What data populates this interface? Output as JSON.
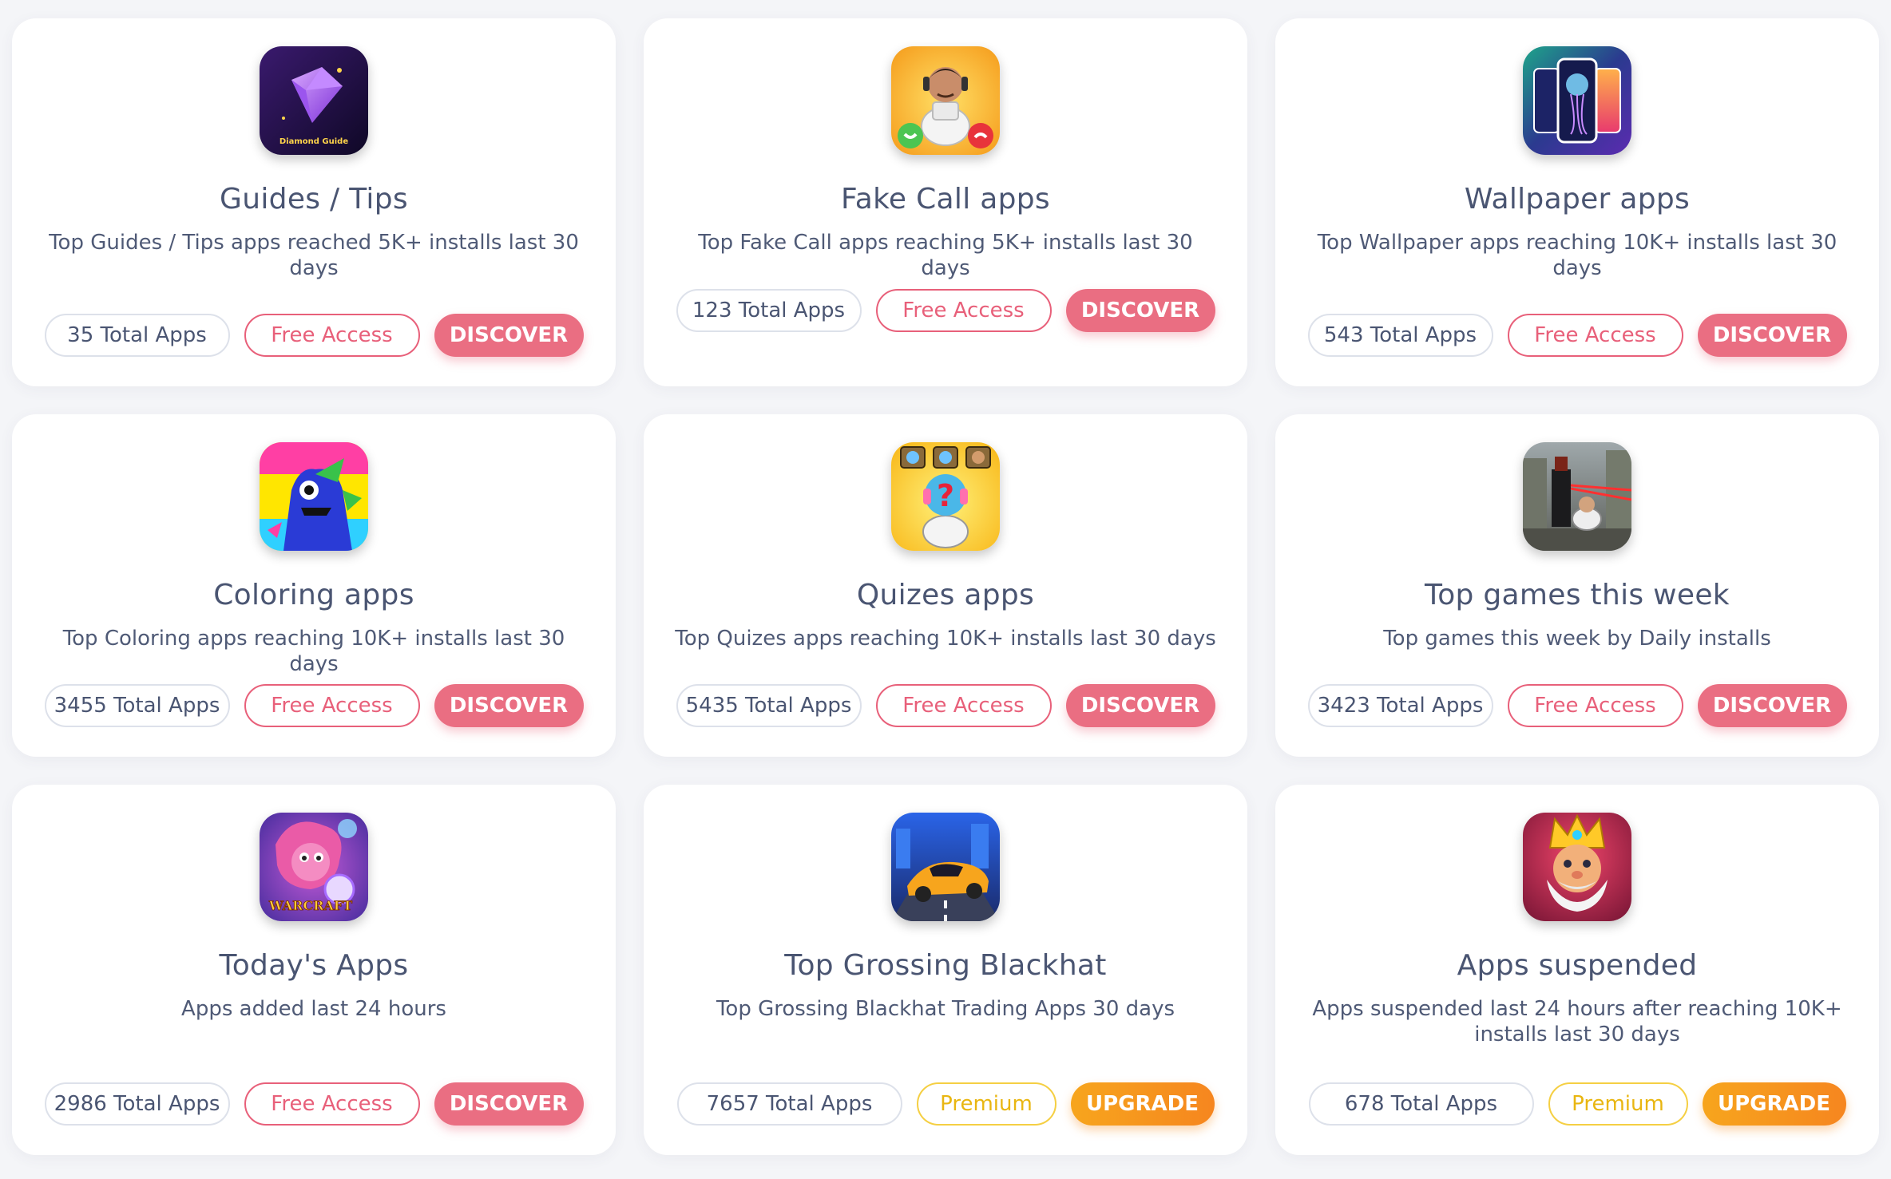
{
  "cards": [
    {
      "title": "Guides / Tips",
      "description": "Top Guides / Tips apps reached 5K+ installs last 30 days",
      "total": "35 Total Apps",
      "access": "Free Access",
      "action": "DISCOVER",
      "icon": "diamond-guide-icon",
      "icon_text": "Diamond Guide"
    },
    {
      "title": "Fake Call apps",
      "description": "Top Fake Call apps reaching 5K+ installs last 30 days",
      "total": "123 Total Apps",
      "access": "Free Access",
      "action": "DISCOVER",
      "icon": "fake-call-icon"
    },
    {
      "title": "Wallpaper apps",
      "description": "Top Wallpaper apps reaching 10K+ installs last 30 days",
      "total": "543 Total Apps",
      "access": "Free Access",
      "action": "DISCOVER",
      "icon": "wallpaper-icon"
    },
    {
      "title": "Coloring apps",
      "description": "Top Coloring apps reaching 10K+ installs last 30 days",
      "total": "3455 Total Apps",
      "access": "Free Access",
      "action": "DISCOVER",
      "icon": "coloring-monster-icon"
    },
    {
      "title": "Quizes apps",
      "description": "Top Quizes apps reaching 10K+ installs last 30 days",
      "total": "5435 Total Apps",
      "access": "Free Access",
      "action": "DISCOVER",
      "icon": "quiz-toilet-icon"
    },
    {
      "title": "Top games this week",
      "description": "Top games this week by Daily installs",
      "total": "3423 Total Apps",
      "access": "Free Access",
      "action": "DISCOVER",
      "icon": "game-city-icon"
    },
    {
      "title": "Today's Apps",
      "description": "Apps added last 24 hours",
      "total": "2986 Total Apps",
      "access": "Free Access",
      "action": "DISCOVER",
      "icon": "warcraft-icon",
      "icon_text": "WARCRAFT"
    },
    {
      "title": "Top Grossing Blackhat",
      "description": "Top Grossing Blackhat Trading Apps 30 days",
      "total": "7657 Total Apps",
      "access": "Premium",
      "action": "UPGRADE",
      "icon": "racing-car-icon"
    },
    {
      "title": "Apps suspended",
      "description": "Apps suspended last 24 hours after reaching 10K+ installs last 30 days",
      "total": "678 Total Apps",
      "access": "Premium",
      "action": "UPGRADE",
      "icon": "king-icon"
    }
  ],
  "colors": {
    "discover": "#ea6e82",
    "free_access": "#e8607a",
    "premium": "#f5cf43",
    "upgrade": "#f6861f",
    "background": "#f4f5f8"
  }
}
